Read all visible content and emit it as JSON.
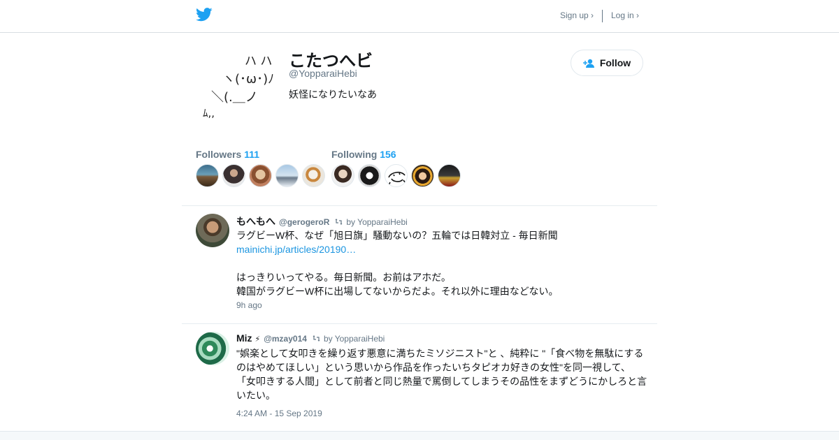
{
  "topbar": {
    "signup_label": "Sign up ›",
    "login_label": "Log in ›"
  },
  "profile": {
    "name": "こたつへビ",
    "handle": "@YopparaiHebi",
    "bio": "妖怪になりたいなあ",
    "avatar_lines": [
      "ハ ハ",
      "ヽ(･ω･)ﾉ",
      "＼(.＿ノ",
      "ﾑ,,"
    ],
    "follow_label": "Follow"
  },
  "stats": {
    "followers_label": "Followers",
    "followers_count": "111",
    "following_label": "Following",
    "following_count": "156"
  },
  "tweets": [
    {
      "name": "もへもへ",
      "handle": "@gerogeroR",
      "retweeted_by": "by YopparaiHebi",
      "line1": "ラグビーW杯、なぜ「旭日旗」騒動ないの？五輪では日韓対立 - 毎日新聞",
      "link": "mainichi.jp/articles/20190…",
      "line2": "はっきりいってやる。毎日新聞。お前はアホだ。",
      "line3": "韓国がラグビーW杯に出場してないからだよ。それ以外に理由などない。",
      "time": "9h ago"
    },
    {
      "name": "Miz",
      "name_suffix": "⚡",
      "handle": "@mzay014",
      "retweeted_by": "by YopparaiHebi",
      "line1": "\"娯楽として女叩きを繰り返す悪意に満ちたミソジニスト\"と 、純粋に \"「食べ物を無駄にする",
      "line2": "のはやめてほしい」という思いから作品を作ったいちタピオカ好きの女性\"を同一視して、",
      "line3": "「女叩きする人間」として前者と同じ熱量で罵倒してしまうその品性をまずどうにかしろと言",
      "line4": "いたい。",
      "time": "4:24 AM - 15 Sep 2019"
    }
  ],
  "colors": {
    "accent": "#1da1f2",
    "link": "#1b95e0",
    "muted": "#657786",
    "text": "#14171a",
    "border": "#e6ecf0"
  }
}
